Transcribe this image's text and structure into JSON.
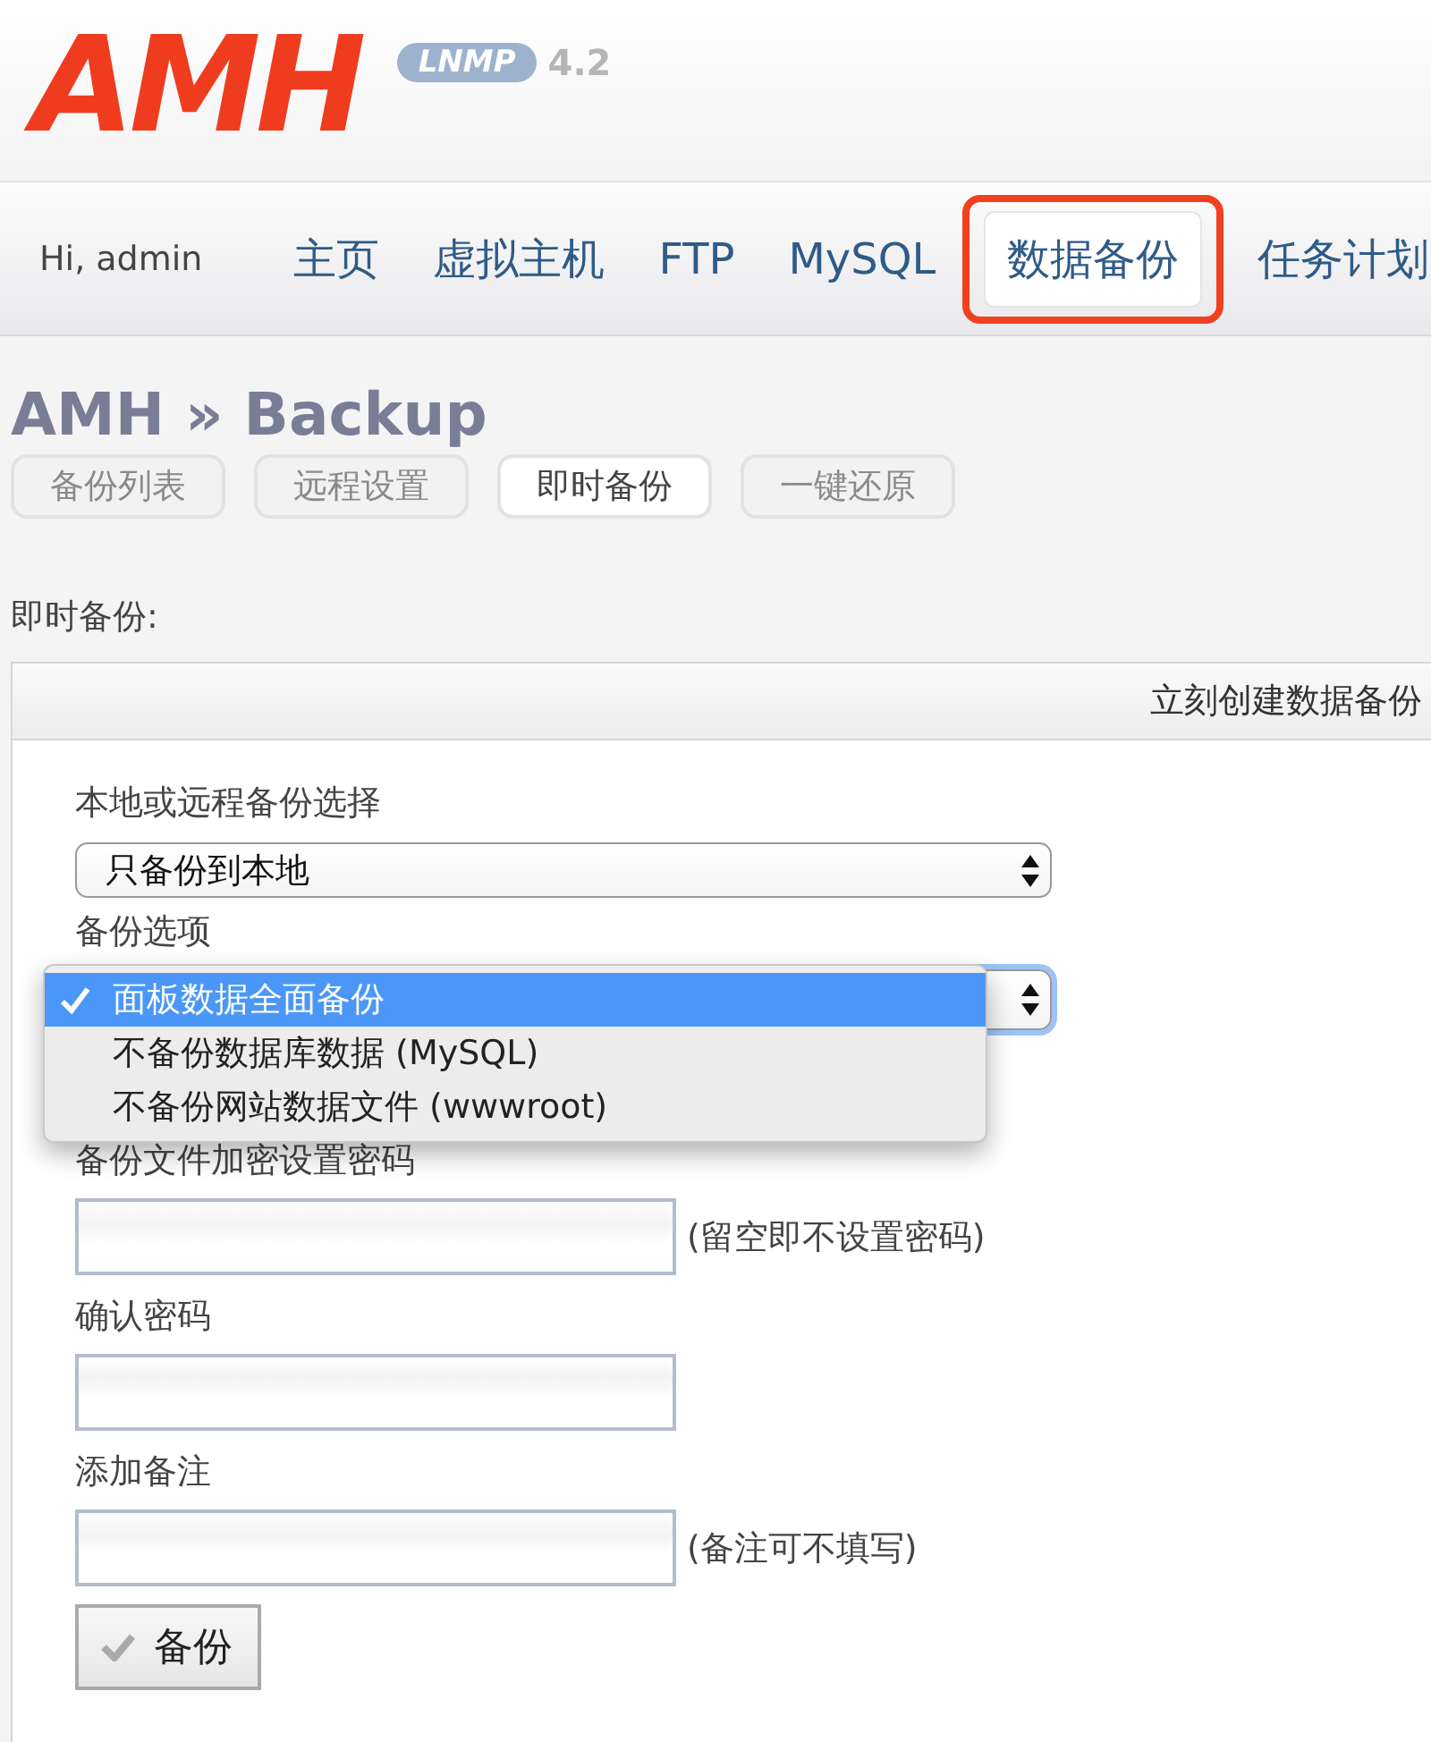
{
  "logo": {
    "text": "AMH",
    "badge": "LNMP",
    "version": "4.2"
  },
  "nav": {
    "greeting": "Hi, admin",
    "items": [
      {
        "label": "主页",
        "selected": false,
        "highlighted": false
      },
      {
        "label": "虚拟主机",
        "selected": false,
        "highlighted": false
      },
      {
        "label": "FTP",
        "selected": false,
        "highlighted": false
      },
      {
        "label": "MySQL",
        "selected": false,
        "highlighted": false
      },
      {
        "label": "数据备份",
        "selected": true,
        "highlighted": true
      },
      {
        "label": "任务计划",
        "selected": false,
        "highlighted": false
      }
    ]
  },
  "page_title": "AMH » Backup",
  "sub_tabs": [
    {
      "label": "备份列表",
      "selected": false
    },
    {
      "label": "远程设置",
      "selected": false
    },
    {
      "label": "即时备份",
      "selected": true
    },
    {
      "label": "一键还原",
      "selected": false
    }
  ],
  "section_label": "即时备份:",
  "panel": {
    "header": "立刻创建数据备份",
    "fields": [
      {
        "kind": "select",
        "label": "本地或远程备份选择",
        "value": "只备份到本地",
        "expanded": false
      },
      {
        "kind": "select",
        "label": "备份选项",
        "expanded": true,
        "options": [
          {
            "label": "面板数据全面备份",
            "selected": true
          },
          {
            "label": "不备份数据库数据 (MySQL)",
            "selected": false
          },
          {
            "label": "不备份网站数据文件 (wwwroot)",
            "selected": false
          }
        ]
      },
      {
        "kind": "input",
        "label": "备份文件加密设置密码",
        "hint": "(留空即不设置密码)"
      },
      {
        "kind": "input",
        "label": "确认密码"
      },
      {
        "kind": "input",
        "label": "添加备注",
        "hint": "(备注可不填写)"
      }
    ],
    "submit": "备份"
  }
}
